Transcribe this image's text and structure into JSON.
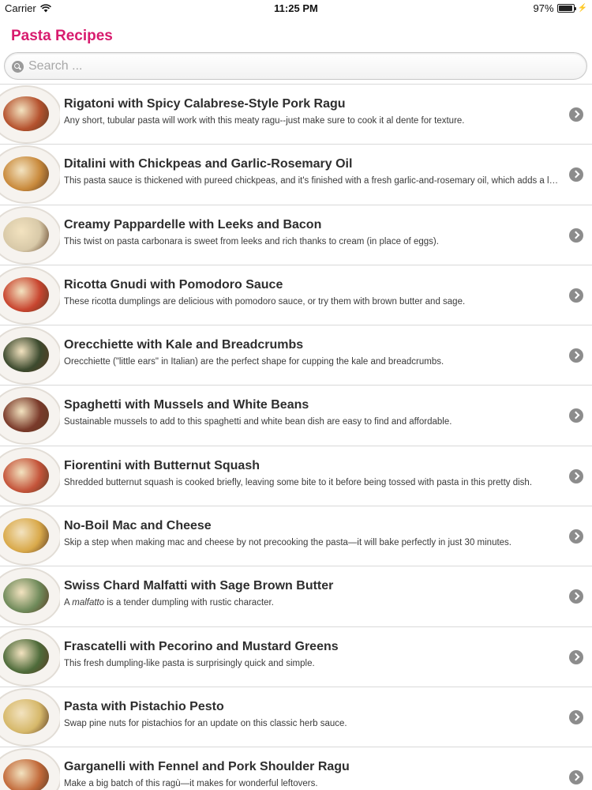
{
  "status_bar": {
    "carrier": "Carrier",
    "time": "11:25 PM",
    "battery": "97%",
    "battery_level": 0.97
  },
  "header": {
    "title": "Pasta Recipes",
    "title_color": "#d81b6e"
  },
  "search": {
    "placeholder": "Search ...",
    "value": ""
  },
  "icons": {
    "search": "search-icon",
    "disclosure": "chevron-right-icon",
    "wifi": "wifi-icon",
    "battery": "battery-icon"
  },
  "recipes": [
    {
      "title": "Rigatoni with Spicy Calabrese-Style Pork Ragu",
      "description": "Any short, tubular pasta will work with this meaty ragu--just make sure to cook it al dente for texture.",
      "thumb_color": "#b5522e"
    },
    {
      "title": "Ditalini with Chickpeas and Garlic-Rosemary Oil",
      "description": "This pasta sauce is thickened with pureed chickpeas, and it's finished with a fresh garlic-and-rosemary oil, which adds a lovely herbal note.",
      "thumb_color": "#c98a3c"
    },
    {
      "title": "Creamy Pappardelle with Leeks and Bacon",
      "description": "This twist on pasta carbonara is sweet from leeks and rich thanks to cream (in place of eggs).",
      "thumb_color": "#d8c9a8"
    },
    {
      "title": "Ricotta Gnudi with Pomodoro Sauce",
      "description": "These ricotta dumplings are delicious with pomodoro sauce, or try them with brown butter and sage.",
      "thumb_color": "#c8452f"
    },
    {
      "title": "Orecchiette with Kale and Breadcrumbs",
      "description": "Orecchiette (\"little ears\" in Italian) are the perfect shape for cupping the kale and breadcrumbs.",
      "thumb_color": "#3c4a2e"
    },
    {
      "title": "Spaghetti with Mussels and White Beans",
      "description": "Sustainable mussels to add to this spaghetti and white bean dish are easy to find and affordable.",
      "thumb_color": "#7a3a2a"
    },
    {
      "title": "Fiorentini with Butternut Squash",
      "description": "Shredded butternut squash is cooked briefly, leaving some bite to it before being tossed with pasta in this pretty dish.",
      "thumb_color": "#c4543a"
    },
    {
      "title": "No-Boil Mac and Cheese",
      "description": "Skip a step when making mac and cheese by not precooking the pasta—it will bake perfectly in just 30 minutes.",
      "thumb_color": "#d9a94a"
    },
    {
      "title": "Swiss Chard Malfatti with Sage Brown Butter",
      "description_prefix": "A ",
      "description_italic": "malfatto",
      "description_suffix": " is a tender dumpling with rustic character.",
      "thumb_color": "#6f8a5a"
    },
    {
      "title": "Frascatelli with Pecorino and Mustard Greens",
      "description": "This fresh dumpling-like pasta is surprisingly quick and simple.",
      "thumb_color": "#4e6b3a"
    },
    {
      "title": "Pasta with Pistachio Pesto",
      "description": "Swap pine nuts for pistachios for an update on this classic herb sauce.",
      "thumb_color": "#d6b86a"
    },
    {
      "title": "Garganelli with Fennel and Pork Shoulder Ragu",
      "description": "Make a big batch of this ragù—it makes for wonderful leftovers.",
      "thumb_color": "#c26a3a"
    }
  ]
}
